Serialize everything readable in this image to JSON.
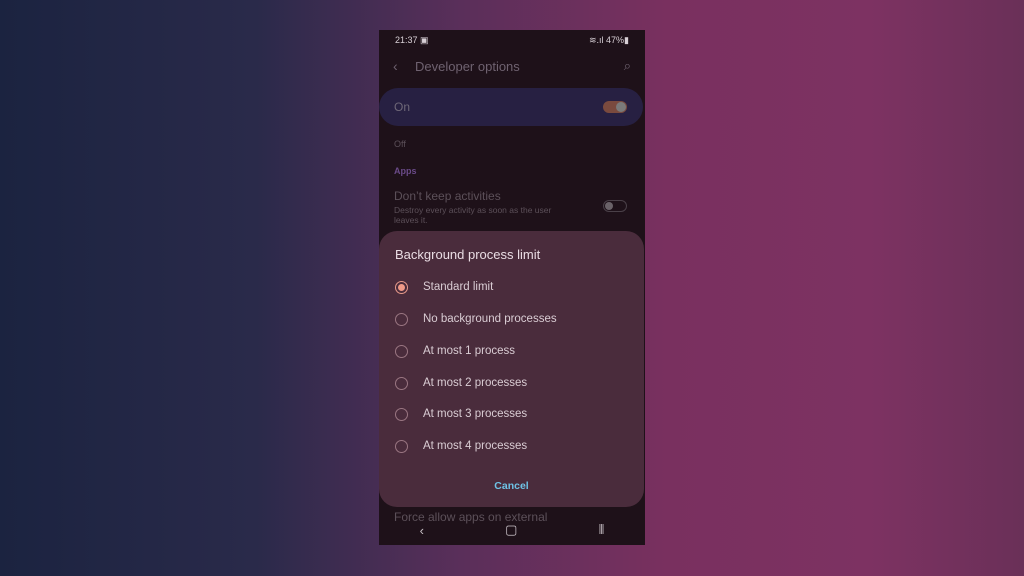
{
  "status": {
    "time": "21:37",
    "battery": "47%"
  },
  "appbar": {
    "title": "Developer options"
  },
  "master": {
    "label": "On",
    "on": true
  },
  "background": {
    "off_text": "Off",
    "section": "Apps",
    "item_title": "Don’t keep activities",
    "item_desc": "Destroy every activity as soon as the user leaves it.",
    "footer_item": "Force allow apps on external"
  },
  "dialog": {
    "title": "Background process limit",
    "selected": 0,
    "options": [
      {
        "label": "Standard limit"
      },
      {
        "label": "No background processes"
      },
      {
        "label": "At most 1 process"
      },
      {
        "label": "At most 2 processes"
      },
      {
        "label": "At most 3 processes"
      },
      {
        "label": "At most 4 processes"
      }
    ],
    "cancel": "Cancel"
  }
}
